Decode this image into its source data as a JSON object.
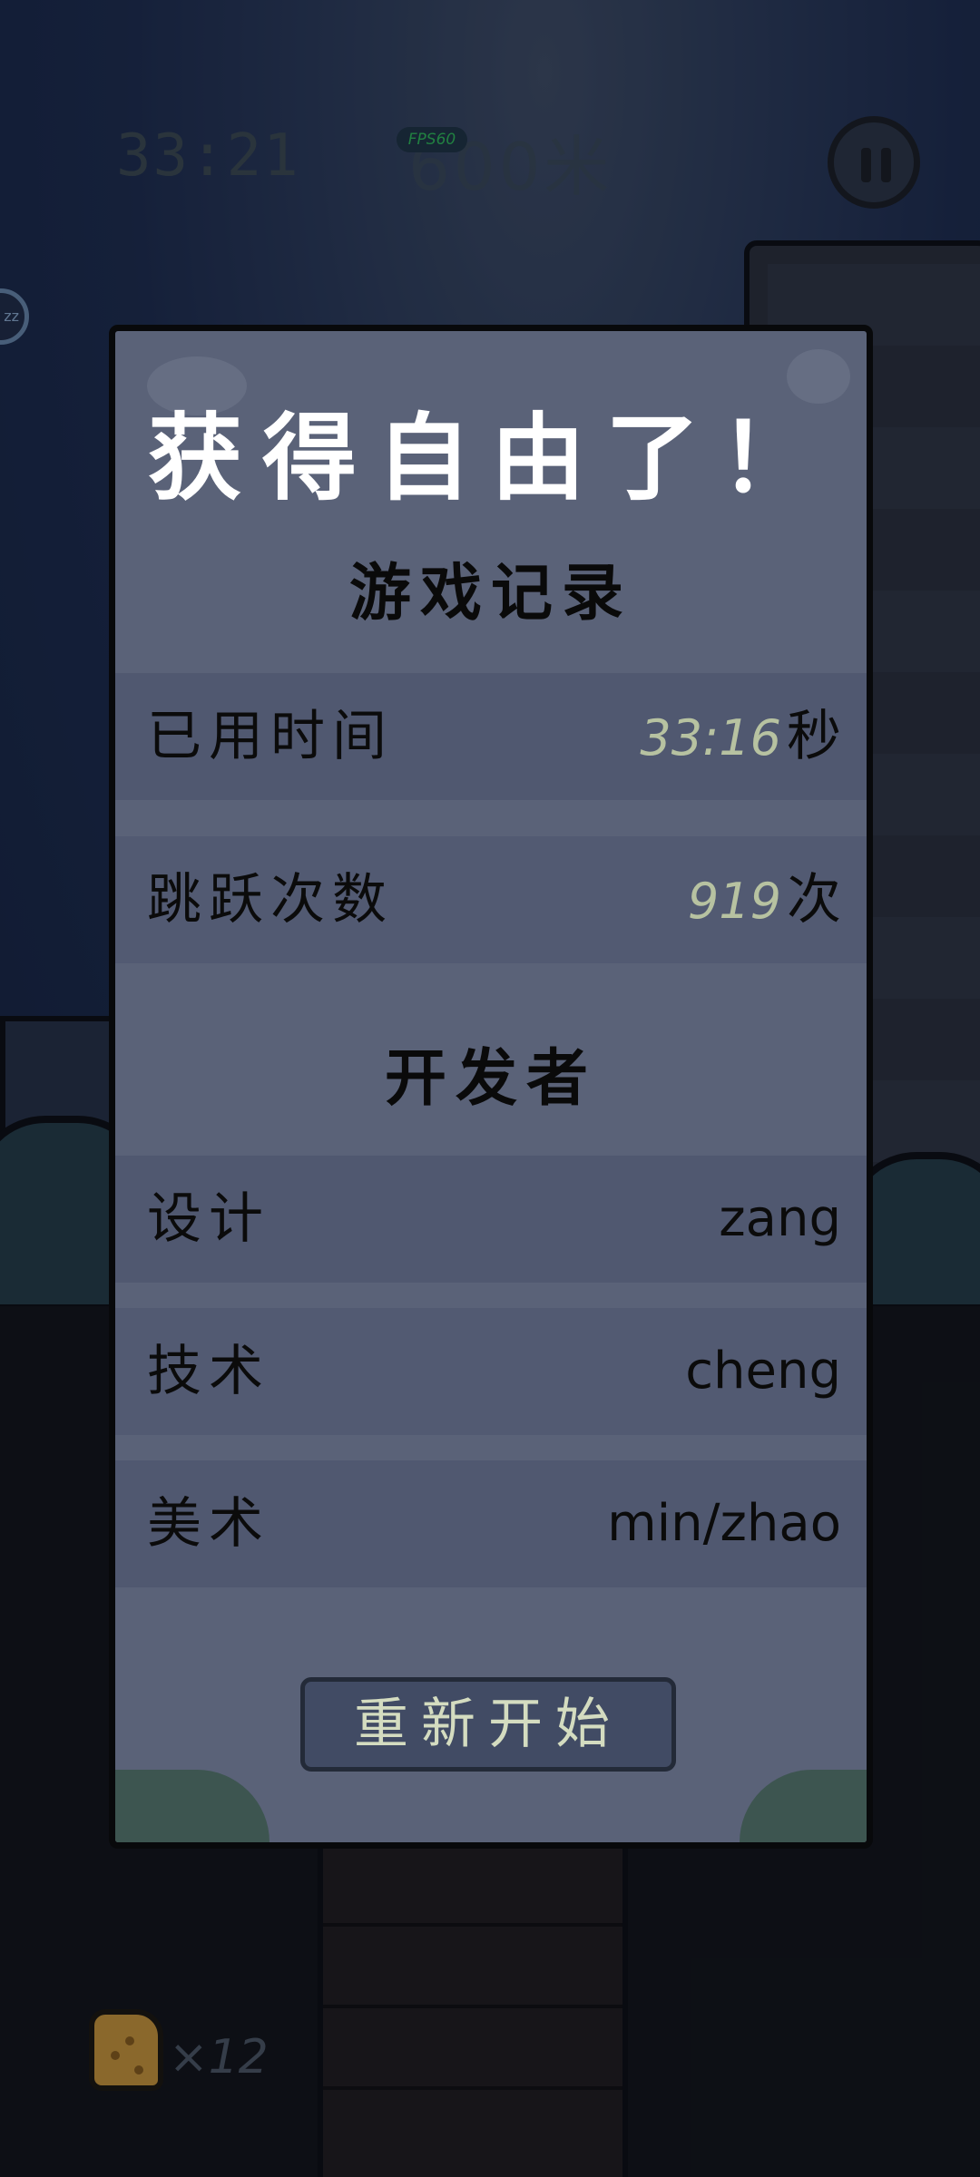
{
  "hud": {
    "time": "33:21",
    "fps": "FPS60",
    "distance": "600米",
    "side_badge": "zz"
  },
  "result": {
    "title": "获得自由了！",
    "record_heading": "游戏记录",
    "elapsed_label": "已用时间",
    "elapsed_value": "33:16",
    "elapsed_unit": "秒",
    "jumps_label": "跳跃次数",
    "jumps_value": "919",
    "jumps_unit": "次",
    "developers_heading": "开发者",
    "credits": [
      {
        "role": "设计",
        "name": "zang"
      },
      {
        "role": "技术",
        "name": "cheng"
      },
      {
        "role": "美术",
        "name": "min/zhao"
      }
    ],
    "restart_label": "重新开始"
  },
  "inventory": {
    "item_count": "×12"
  }
}
